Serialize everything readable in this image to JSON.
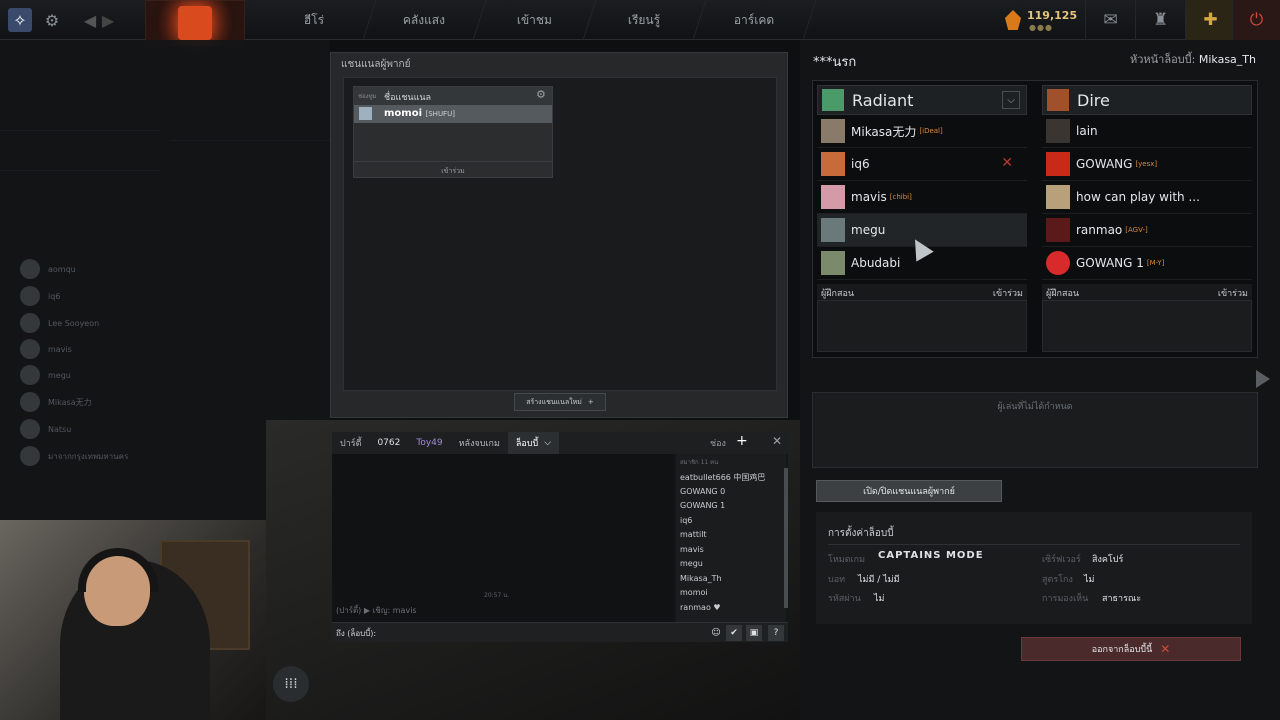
{
  "topbar": {
    "nav": [
      "ฮีโร่",
      "คลังแสง",
      "เข้าชม",
      "เรียนรู้",
      "อาร์เคด"
    ],
    "currency_value": "119,125",
    "currency_sub": "●●●"
  },
  "icons": {
    "dota_menu": "dota-menu-icon",
    "settings": "gear-icon",
    "back": "back-arrow-icon",
    "forward": "forward-arrow-icon",
    "mail": "mail-icon",
    "trophy": "trophy-icon",
    "plus": "plus-icon",
    "power": "power-icon"
  },
  "friends_blur": {
    "items": [
      "aomqu",
      "iq6",
      "Lee Sooyeon",
      "mavis",
      "megu",
      "Mikasa无力",
      "Natsu",
      "มาจากกรุงเทพมหานคร"
    ]
  },
  "teams_panel": {
    "title": "แชนแนลผู้พากย์",
    "card_small": "ช่องทูม",
    "card_title": "ชื่อแชนแนล",
    "player_name": "momoi",
    "player_tag": "[SHUFU]",
    "join": "เข้าร่วม",
    "create": "สร้างแชนแนลใหม่"
  },
  "chat": {
    "tabs": [
      "ปาร์ตี้",
      "0762",
      "Toy49",
      "หลังจบเกม",
      "ล็อบบี้"
    ],
    "channels_label": "ช่อง",
    "time": "20:57 น.",
    "system_line": "(ปาร์ตี้) ▶ เชิญ: mavis",
    "member_header": "สมาชิก 11 คน",
    "members": [
      "eatbullet666 中国鸡巴",
      "GOWANG 0",
      "GOWANG 1",
      "iq6",
      "mattilt",
      "mavis",
      "megu",
      "Mikasa_Th",
      "momoi",
      "ranmao ♥"
    ],
    "input_label": "ถึง (ล็อบบี้):"
  },
  "lobby": {
    "name": "***นรก",
    "host_label": "หัวหน้าล็อบบี้:",
    "host_name": "Mikasa_Th",
    "radiant": {
      "name": "Radiant",
      "players": [
        {
          "name": "Mikasa无力",
          "tag": "[iDeal]",
          "kick": false
        },
        {
          "name": "iq6",
          "tag": "",
          "kick": true
        },
        {
          "name": "mavis",
          "tag": "[chibi]",
          "kick": false
        },
        {
          "name": "megu",
          "tag": "",
          "kick": false
        },
        {
          "name": "Abudabi",
          "tag": "",
          "kick": false
        }
      ]
    },
    "dire": {
      "name": "Dire",
      "players": [
        {
          "name": "lain",
          "tag": ""
        },
        {
          "name": "GOWANG",
          "tag": "[yesx]"
        },
        {
          "name": "how can play with ...",
          "tag": ""
        },
        {
          "name": "ranmao",
          "tag": "[AGV-]"
        },
        {
          "name": "GOWANG 1",
          "tag": "[M-Y]"
        }
      ]
    },
    "coach_label": "ผู้ฝึกสอน",
    "coach_join": "เข้าร่วม",
    "unassigned": "ผู้เล่นที่ไม่ได้กำหนด",
    "toggle_btn": "เปิด/ปิดแชนแนลผู้พากย์",
    "settings_title": "การตั้งค่าล็อบบี้",
    "settings": {
      "mode_label": "โหมดเกม",
      "mode": "CAPTAINS MODE",
      "server_label": "เซิร์ฟเวอร์",
      "server": "สิงคโปร์",
      "bots_label": "บอท",
      "bots": "ไม่มี / ไม่มี",
      "cheats_label": "สูตรโกง",
      "cheats": "ไม่",
      "pass_label": "รหัสผ่าน",
      "pass": "ไม่",
      "visibility_label": "การมองเห็น",
      "visibility": "สาธารณะ"
    },
    "leave": "ออกจากล็อบบี้นี้"
  },
  "colors": {
    "radiant_ico": "#4a9a6a",
    "dire_ico": "#a0502a",
    "kick": "#b33a2e",
    "tag": "#d88a3a"
  }
}
